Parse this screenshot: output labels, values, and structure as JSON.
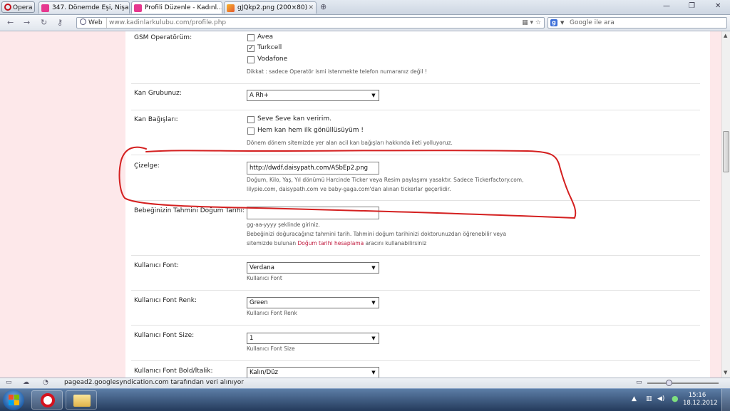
{
  "browser": {
    "menu_label": "Opera",
    "tabs": [
      {
        "label": "347. Dönemde Eşi, Nişa...",
        "active": false
      },
      {
        "label": "Profili Düzenle - Kadınl...",
        "active": true
      },
      {
        "label": "gJQkp2.png (200×80)",
        "active": false
      }
    ],
    "address_mode": "Web",
    "url": "www.kadinlarkulubu.com/profile.php",
    "search_placeholder": "Google ile ara",
    "search_engine_letter": "g"
  },
  "form": {
    "gsm": {
      "label": "GSM Operatörüm:",
      "options": [
        {
          "label": "Avea",
          "checked": false
        },
        {
          "label": "Turkcell",
          "checked": true
        },
        {
          "label": "Vodafone",
          "checked": false
        }
      ],
      "help": "Dikkat : sadece Operatör ismi istenmekte telefon numaranız değil !"
    },
    "blood_group": {
      "label": "Kan Grubunuz:",
      "value": "A Rh+"
    },
    "blood_donation": {
      "label": "Kan Bağışları:",
      "options": [
        {
          "label": "Seve Seve kan veririm.",
          "checked": false
        },
        {
          "label": "Hem kan hem ilk gönüllüsüyüm !",
          "checked": false
        }
      ],
      "help": "Dönem dönem sitemizde yer alan acil kan bağışları hakkında ileti yolluyoruz."
    },
    "ticker": {
      "label": "Çizelge:",
      "value": "http://dwdf.daisypath.com/ASbEp2.png",
      "help_line1": "Doğum, Kilo, Yaş, Yıl dönümü Harcinde Ticker veya Resim paylaşımı yasaktır. Sadece Tickerfactory.com,",
      "help_line2": "lilypie.com, daisypath.com ve baby-gaga.com'dan alınan tickerlar geçerlidir."
    },
    "due_date": {
      "label": "Bebeğinizin Tahmini Doğum Tarihi:",
      "value": "",
      "help_line1": "gg-aa-yyyy şeklinde giriniz.",
      "help_line2": "Bebeğinizi doğuracağınız tahmini tarih. Tahmini doğum tarihinizi doktorunuzdan öğrenebilir veya",
      "help_line3_pre": "sitemizde bulunan ",
      "help_link": "Doğum tarihi hesaplama",
      "help_line3_post": " aracını kullanabilirsiniz"
    },
    "user_font": {
      "label": "Kullanıcı Font:",
      "value": "Verdana",
      "help": "Kullanıcı Font"
    },
    "user_font_color": {
      "label": "Kullanıcı Font Renk:",
      "value": "Green",
      "help": "Kullanıcı Font Renk"
    },
    "user_font_size": {
      "label": "Kullanıcı Font Size:",
      "value": "1",
      "help": "Kullanıcı Font Size"
    },
    "user_font_style": {
      "label": "Kullanıcı Font Bold/İtalik:",
      "value": "Kalın/Düz"
    }
  },
  "status": {
    "text": "pagead2.googlesyndication.com tarafından veri alınıyor"
  },
  "taskbar": {
    "time": "15:16",
    "date": "18.12.2012"
  },
  "colors": {
    "page_bg": "#fde8ea",
    "annotation": "#d42020",
    "link": "#c0183c"
  }
}
